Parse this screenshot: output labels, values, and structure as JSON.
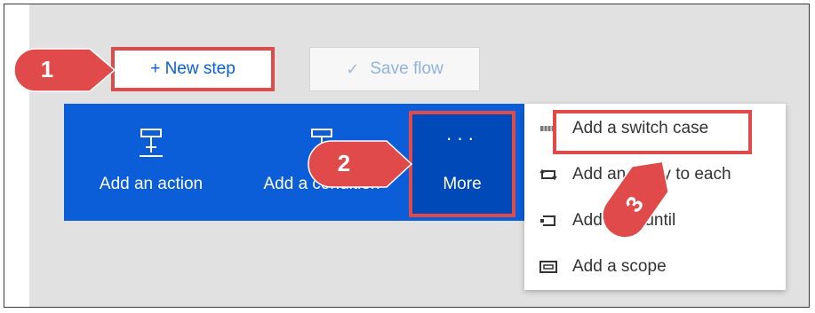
{
  "toolbar": {
    "new_step_label": "+ New step",
    "save_flow_label": "Save flow"
  },
  "action_bar": {
    "add_action_label": "Add an action",
    "add_condition_label": "Add a condition",
    "more_dots": "···",
    "more_label": "More"
  },
  "more_menu": {
    "items": [
      {
        "label": "Add a switch case",
        "icon": "switch-case-icon"
      },
      {
        "label": "Add an apply to each",
        "icon": "apply-to-each-icon"
      },
      {
        "label": "Add a do until",
        "icon": "do-until-icon"
      },
      {
        "label": "Add a scope",
        "icon": "scope-icon"
      }
    ]
  },
  "callouts": {
    "one": "1",
    "two": "2",
    "three": "3"
  },
  "colors": {
    "accent_blue": "#0b5ed8",
    "more_blue": "#0049b8",
    "callout_red": "#e04a4a",
    "canvas_gray": "#e1e1e1"
  }
}
